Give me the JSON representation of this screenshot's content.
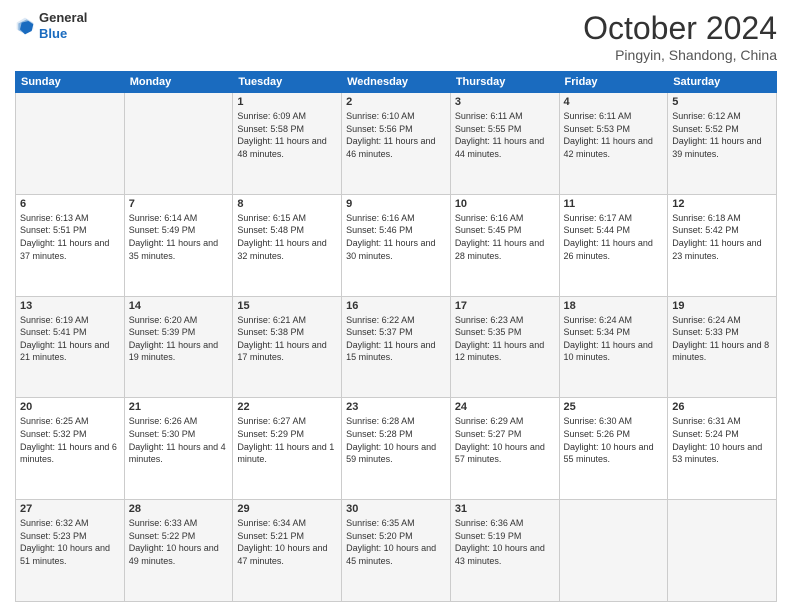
{
  "header": {
    "logo_line1": "General",
    "logo_line2": "Blue",
    "month": "October 2024",
    "location": "Pingyin, Shandong, China"
  },
  "days_of_week": [
    "Sunday",
    "Monday",
    "Tuesday",
    "Wednesday",
    "Thursday",
    "Friday",
    "Saturday"
  ],
  "weeks": [
    [
      {
        "day": "",
        "sunrise": "",
        "sunset": "",
        "daylight": ""
      },
      {
        "day": "",
        "sunrise": "",
        "sunset": "",
        "daylight": ""
      },
      {
        "day": "1",
        "sunrise": "Sunrise: 6:09 AM",
        "sunset": "Sunset: 5:58 PM",
        "daylight": "Daylight: 11 hours and 48 minutes."
      },
      {
        "day": "2",
        "sunrise": "Sunrise: 6:10 AM",
        "sunset": "Sunset: 5:56 PM",
        "daylight": "Daylight: 11 hours and 46 minutes."
      },
      {
        "day": "3",
        "sunrise": "Sunrise: 6:11 AM",
        "sunset": "Sunset: 5:55 PM",
        "daylight": "Daylight: 11 hours and 44 minutes."
      },
      {
        "day": "4",
        "sunrise": "Sunrise: 6:11 AM",
        "sunset": "Sunset: 5:53 PM",
        "daylight": "Daylight: 11 hours and 42 minutes."
      },
      {
        "day": "5",
        "sunrise": "Sunrise: 6:12 AM",
        "sunset": "Sunset: 5:52 PM",
        "daylight": "Daylight: 11 hours and 39 minutes."
      }
    ],
    [
      {
        "day": "6",
        "sunrise": "Sunrise: 6:13 AM",
        "sunset": "Sunset: 5:51 PM",
        "daylight": "Daylight: 11 hours and 37 minutes."
      },
      {
        "day": "7",
        "sunrise": "Sunrise: 6:14 AM",
        "sunset": "Sunset: 5:49 PM",
        "daylight": "Daylight: 11 hours and 35 minutes."
      },
      {
        "day": "8",
        "sunrise": "Sunrise: 6:15 AM",
        "sunset": "Sunset: 5:48 PM",
        "daylight": "Daylight: 11 hours and 32 minutes."
      },
      {
        "day": "9",
        "sunrise": "Sunrise: 6:16 AM",
        "sunset": "Sunset: 5:46 PM",
        "daylight": "Daylight: 11 hours and 30 minutes."
      },
      {
        "day": "10",
        "sunrise": "Sunrise: 6:16 AM",
        "sunset": "Sunset: 5:45 PM",
        "daylight": "Daylight: 11 hours and 28 minutes."
      },
      {
        "day": "11",
        "sunrise": "Sunrise: 6:17 AM",
        "sunset": "Sunset: 5:44 PM",
        "daylight": "Daylight: 11 hours and 26 minutes."
      },
      {
        "day": "12",
        "sunrise": "Sunrise: 6:18 AM",
        "sunset": "Sunset: 5:42 PM",
        "daylight": "Daylight: 11 hours and 23 minutes."
      }
    ],
    [
      {
        "day": "13",
        "sunrise": "Sunrise: 6:19 AM",
        "sunset": "Sunset: 5:41 PM",
        "daylight": "Daylight: 11 hours and 21 minutes."
      },
      {
        "day": "14",
        "sunrise": "Sunrise: 6:20 AM",
        "sunset": "Sunset: 5:39 PM",
        "daylight": "Daylight: 11 hours and 19 minutes."
      },
      {
        "day": "15",
        "sunrise": "Sunrise: 6:21 AM",
        "sunset": "Sunset: 5:38 PM",
        "daylight": "Daylight: 11 hours and 17 minutes."
      },
      {
        "day": "16",
        "sunrise": "Sunrise: 6:22 AM",
        "sunset": "Sunset: 5:37 PM",
        "daylight": "Daylight: 11 hours and 15 minutes."
      },
      {
        "day": "17",
        "sunrise": "Sunrise: 6:23 AM",
        "sunset": "Sunset: 5:35 PM",
        "daylight": "Daylight: 11 hours and 12 minutes."
      },
      {
        "day": "18",
        "sunrise": "Sunrise: 6:24 AM",
        "sunset": "Sunset: 5:34 PM",
        "daylight": "Daylight: 11 hours and 10 minutes."
      },
      {
        "day": "19",
        "sunrise": "Sunrise: 6:24 AM",
        "sunset": "Sunset: 5:33 PM",
        "daylight": "Daylight: 11 hours and 8 minutes."
      }
    ],
    [
      {
        "day": "20",
        "sunrise": "Sunrise: 6:25 AM",
        "sunset": "Sunset: 5:32 PM",
        "daylight": "Daylight: 11 hours and 6 minutes."
      },
      {
        "day": "21",
        "sunrise": "Sunrise: 6:26 AM",
        "sunset": "Sunset: 5:30 PM",
        "daylight": "Daylight: 11 hours and 4 minutes."
      },
      {
        "day": "22",
        "sunrise": "Sunrise: 6:27 AM",
        "sunset": "Sunset: 5:29 PM",
        "daylight": "Daylight: 11 hours and 1 minute."
      },
      {
        "day": "23",
        "sunrise": "Sunrise: 6:28 AM",
        "sunset": "Sunset: 5:28 PM",
        "daylight": "Daylight: 10 hours and 59 minutes."
      },
      {
        "day": "24",
        "sunrise": "Sunrise: 6:29 AM",
        "sunset": "Sunset: 5:27 PM",
        "daylight": "Daylight: 10 hours and 57 minutes."
      },
      {
        "day": "25",
        "sunrise": "Sunrise: 6:30 AM",
        "sunset": "Sunset: 5:26 PM",
        "daylight": "Daylight: 10 hours and 55 minutes."
      },
      {
        "day": "26",
        "sunrise": "Sunrise: 6:31 AM",
        "sunset": "Sunset: 5:24 PM",
        "daylight": "Daylight: 10 hours and 53 minutes."
      }
    ],
    [
      {
        "day": "27",
        "sunrise": "Sunrise: 6:32 AM",
        "sunset": "Sunset: 5:23 PM",
        "daylight": "Daylight: 10 hours and 51 minutes."
      },
      {
        "day": "28",
        "sunrise": "Sunrise: 6:33 AM",
        "sunset": "Sunset: 5:22 PM",
        "daylight": "Daylight: 10 hours and 49 minutes."
      },
      {
        "day": "29",
        "sunrise": "Sunrise: 6:34 AM",
        "sunset": "Sunset: 5:21 PM",
        "daylight": "Daylight: 10 hours and 47 minutes."
      },
      {
        "day": "30",
        "sunrise": "Sunrise: 6:35 AM",
        "sunset": "Sunset: 5:20 PM",
        "daylight": "Daylight: 10 hours and 45 minutes."
      },
      {
        "day": "31",
        "sunrise": "Sunrise: 6:36 AM",
        "sunset": "Sunset: 5:19 PM",
        "daylight": "Daylight: 10 hours and 43 minutes."
      },
      {
        "day": "",
        "sunrise": "",
        "sunset": "",
        "daylight": ""
      },
      {
        "day": "",
        "sunrise": "",
        "sunset": "",
        "daylight": ""
      }
    ]
  ]
}
